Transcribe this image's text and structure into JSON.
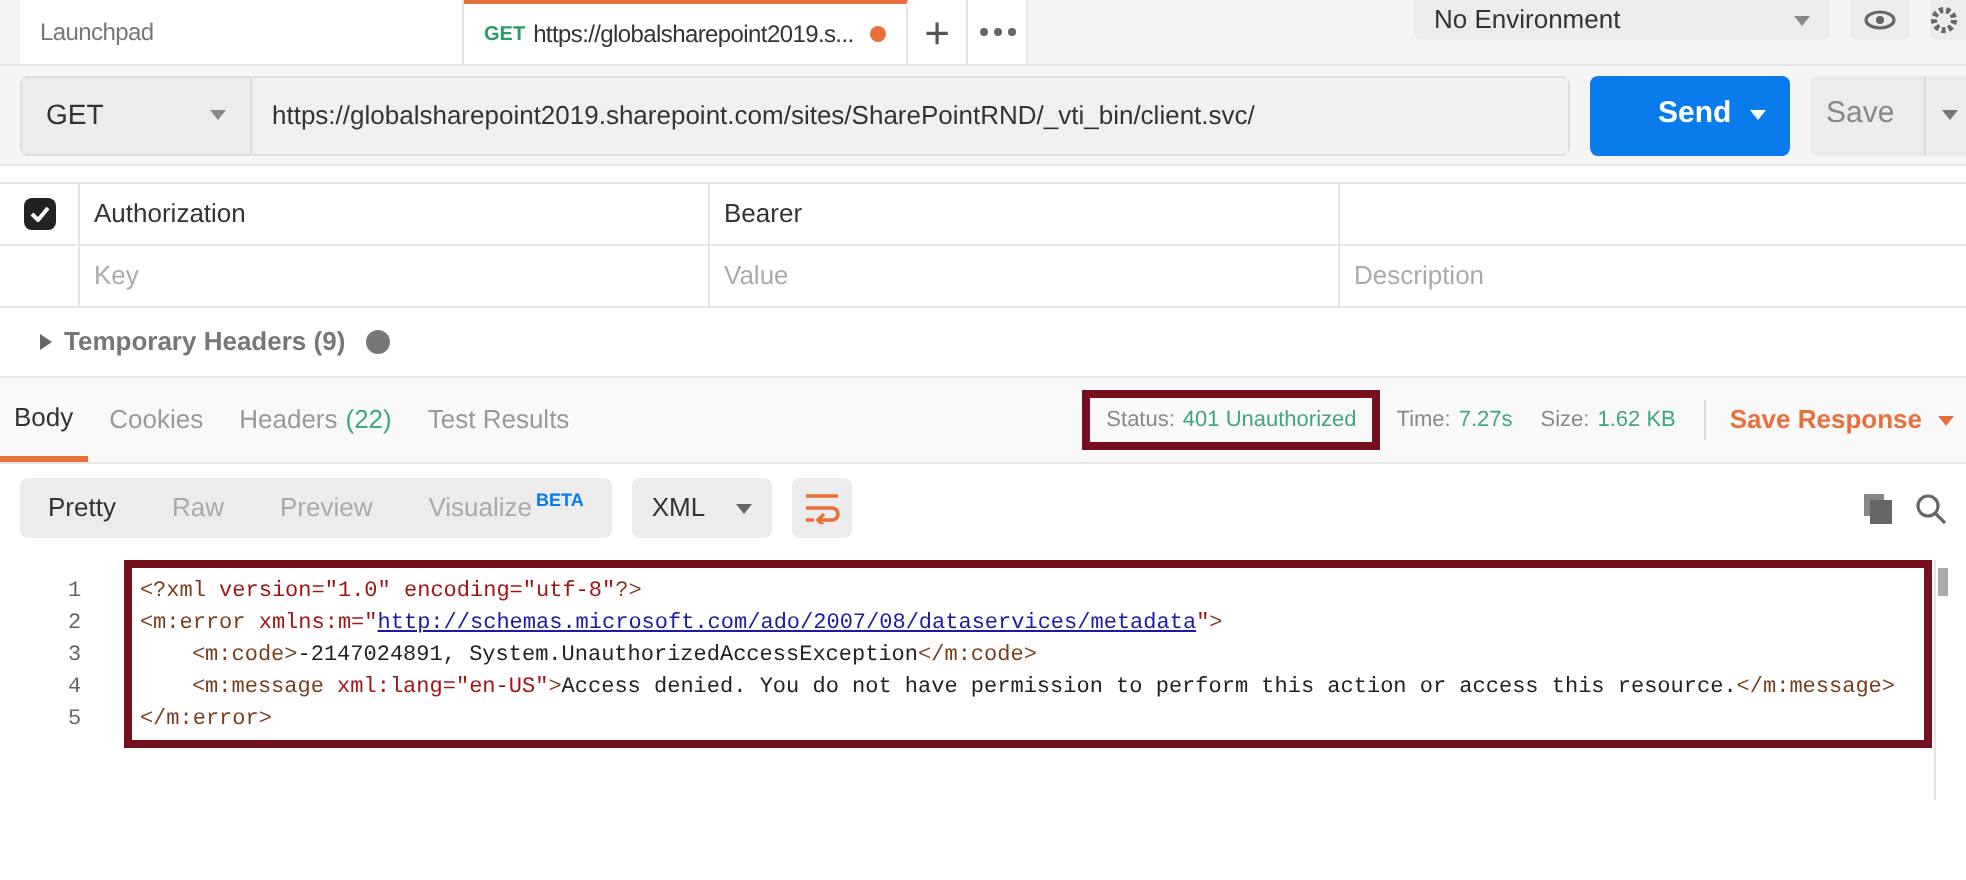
{
  "tabs": [
    {
      "label": "Launchpad",
      "selected": false
    },
    {
      "method": "GET",
      "label": "https://globalsharepoint2019.s...",
      "selected": true,
      "unsaved": true
    }
  ],
  "tab_actions": [
    "+"
  ],
  "environment": {
    "value": "No Environment"
  },
  "request": {
    "method": "GET",
    "url": "https://globalsharepoint2019.sharepoint.com/sites/SharePointRND/_vti_bin/client.svc/",
    "send": "Send",
    "save": "Save"
  },
  "headers_table": {
    "rows": [
      {
        "checked": true,
        "key": "Authorization",
        "value": "Bearer"
      }
    ],
    "new_row": {
      "key_placeholder": "Key",
      "value_placeholder": "Value",
      "description_placeholder": "Description"
    }
  },
  "temporary_headers": {
    "label": "Temporary Headers",
    "count": "(9)",
    "expanded": false
  },
  "response_tabs": [
    {
      "label": "Body",
      "selected": true
    },
    {
      "label": "Cookies",
      "selected": false
    },
    {
      "label": "Headers",
      "count": "(22)",
      "selected": false
    },
    {
      "label": "Test Results",
      "selected": false
    }
  ],
  "response_meta": {
    "status_label": "Status:",
    "status": "401 Unauthorized",
    "status_highlighted": true,
    "time_label": "Time:",
    "time": "7.27s",
    "size_label": "Size:",
    "size": "1.62 KB",
    "save_response": "Save Response"
  },
  "view_modes": [
    {
      "label": "Pretty",
      "selected": true
    },
    {
      "label": "Raw",
      "selected": false
    },
    {
      "label": "Preview",
      "selected": false
    },
    {
      "label": "Visualize",
      "badge": "BETA",
      "selected": false
    }
  ],
  "format": {
    "value": "XML"
  },
  "code": {
    "highlighted": true,
    "lines": [
      {
        "number": "1",
        "indent": false,
        "tokens": [
          {
            "kind": "tag",
            "text": "<?xml"
          },
          {
            "kind": "attr",
            "text": " version="
          },
          {
            "kind": "value",
            "text": "\"1.0\""
          },
          {
            "kind": "attr",
            "text": " encoding="
          },
          {
            "kind": "value",
            "text": "\"utf-8\""
          },
          {
            "kind": "tag",
            "text": "?>"
          }
        ]
      },
      {
        "number": "2",
        "indent": false,
        "tokens": [
          {
            "kind": "tag",
            "text": "<m:error"
          },
          {
            "kind": "attr",
            "text": " xmlns:m="
          },
          {
            "kind": "value",
            "text": "\""
          },
          {
            "kind": "link",
            "text": "http://schemas.microsoft.com/ado/2007/08/dataservices/metadata"
          },
          {
            "kind": "value",
            "text": "\""
          },
          {
            "kind": "tag",
            "text": ">"
          }
        ]
      },
      {
        "number": "3",
        "indent": true,
        "tokens": [
          {
            "kind": "tag",
            "text": "<m:code>"
          },
          {
            "kind": "text",
            "text": "-2147024891, System.UnauthorizedAccessException"
          },
          {
            "kind": "tag",
            "text": "</m:code>"
          }
        ]
      },
      {
        "number": "4",
        "indent": true,
        "tokens": [
          {
            "kind": "tag",
            "text": "<m:message"
          },
          {
            "kind": "attr",
            "text": " xml:lang="
          },
          {
            "kind": "value",
            "text": "\"en-US\""
          },
          {
            "kind": "tag",
            "text": ">"
          },
          {
            "kind": "text",
            "text": "Access denied. You do not have permission to perform this action or access this resource."
          },
          {
            "kind": "tag",
            "text": "</m:message>"
          }
        ]
      },
      {
        "number": "5",
        "indent": false,
        "tokens": [
          {
            "kind": "tag",
            "text": "</m:error>"
          }
        ]
      }
    ]
  }
}
